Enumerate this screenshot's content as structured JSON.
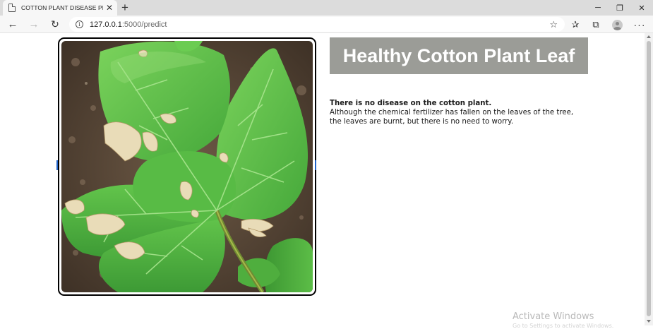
{
  "browser": {
    "tab_title": "COTTON PLANT DISEASE PREDIC",
    "url_host": "127.0.0.1",
    "url_path": ":5000/predict",
    "icons": {
      "tab": "page-icon",
      "tab_close": "close-icon",
      "new_tab": "plus-icon",
      "back": "back-arrow-icon",
      "forward": "forward-arrow-icon",
      "reload": "reload-icon",
      "info": "info-icon",
      "favorite": "star-add-icon",
      "favorites": "favorites-icon",
      "collections": "collections-icon",
      "profile": "profile-icon",
      "more": "more-icon"
    }
  },
  "result": {
    "title": "Healthy Cotton Plant Leaf",
    "heading": "There is no disease on the cotton plant.",
    "description": "Although the chemical fertilizer has fallen on the leaves of the tree, the leaves are burnt, but there is no need to worry."
  },
  "image": {
    "subject": "cotton-leaf-photo"
  },
  "watermark": {
    "text": "Activate Windows",
    "subtext": "Go to Settings to activate Windows."
  },
  "colors": {
    "title_bg": "#9b9c97",
    "leaf_green": "#5fc24a",
    "soil": "#5b4a3a"
  }
}
